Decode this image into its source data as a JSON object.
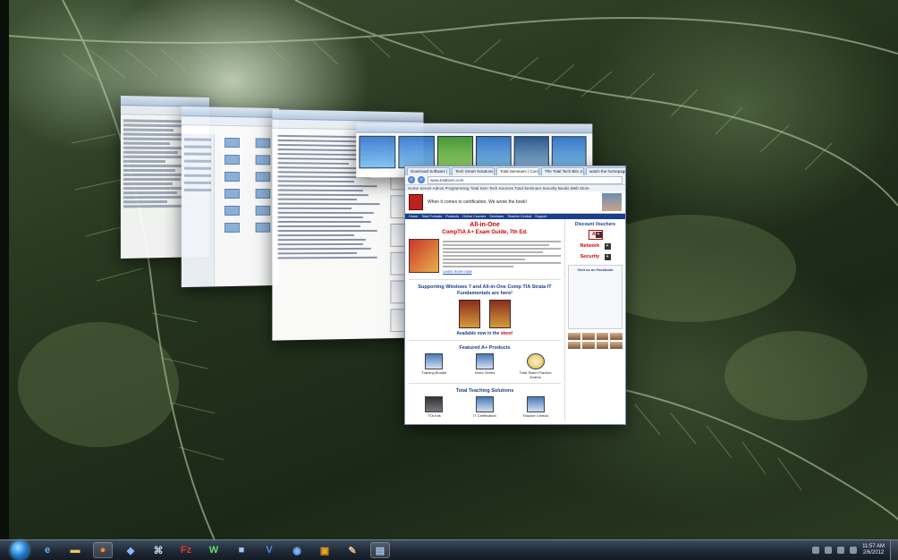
{
  "browser": {
    "tabs": [
      "Download Software | Ch...",
      "Tech Smart Solutions New...",
      "Total Seminars | Comp...",
      "The Total Tech Bits Journal...",
      "watch the homepage to ..."
    ],
    "address": "www.totalsem.com",
    "bookmarks": "Home  Server Admin  Programming  Total Sem  Tech Sources  Total Seminars  Security  Books  Web Store",
    "site": {
      "tagline": "When it comes to certification, We wrote the book!",
      "nav": [
        "Home",
        "Total Formats",
        "Products",
        "Online Courses",
        "Seminars",
        "Teacher Central",
        "Support"
      ],
      "headline": "All-in-One",
      "headline2": "CompTIA A+ Exam Guide, 7th Ed.",
      "learn_more": "Learn more now",
      "supporting": "Supporting Windows 7 and All-in-One Comp TIA Strata IT Fundamentals are here!",
      "available_now": "Available now in the",
      "store": "store!",
      "featured": "Featured A+ Products",
      "products": [
        "Training Bundle",
        "Video Series",
        "Total Tester Practice Exams"
      ],
      "teaching": "Total Teaching Solutions",
      "teaching_items": [
        "TTA Kits",
        "IT Certification",
        "Teacher Central"
      ],
      "sidebar_title": "Discount Vouchers",
      "vouchers": [
        "A+",
        "Network",
        "Security"
      ],
      "fb_title": "Visit us on Facebook"
    }
  },
  "taskbar": {
    "clock_time": "11:57 AM",
    "clock_date": "2/6/2012",
    "icons": [
      "ie-icon",
      "folder-icon",
      "firefox-icon",
      "app-icon",
      "network-icon",
      "filezilla-icon",
      "word-icon",
      "app-box-icon",
      "visio-icon",
      "ie2-icon",
      "media-icon",
      "paint-icon",
      "window-icon"
    ]
  }
}
